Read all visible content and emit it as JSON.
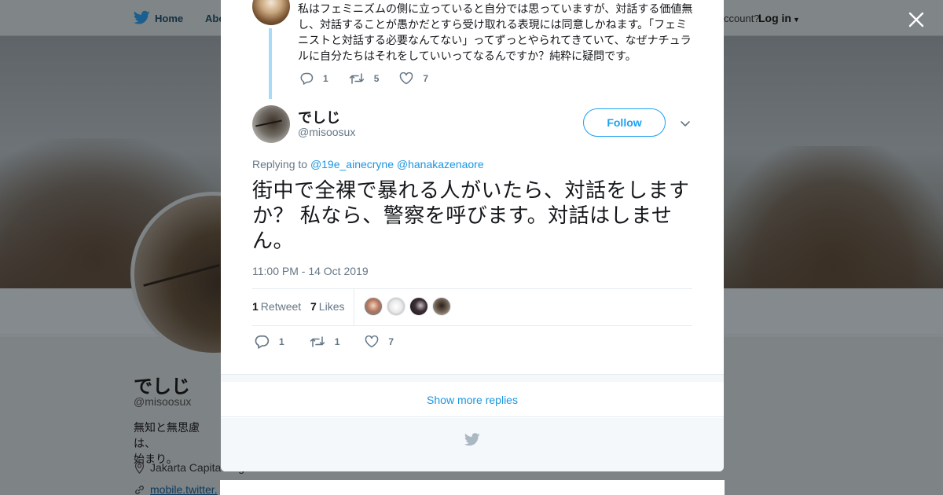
{
  "topbar": {
    "home_label": "Home",
    "about_label": "Abo",
    "account_text": "ccount?",
    "login_label": "Log in"
  },
  "profile": {
    "name": "でしじ",
    "handle": "@misoosux",
    "bio_line1": "無知と無思慮は、",
    "bio_line2": "始まり。",
    "location": "Jakarta Capita",
    "location_tail": "g",
    "url": "mobile.twitter."
  },
  "modal": {
    "previous_tweet": {
      "text": "私はフェミニズムの側に立っていると自分では思っていますが、対話する価値無し、対話することが愚かだとすら受け取れる表現には同意しかねます。「フェミニストと対話する必要なんてない」ってずっとやられてきていて、なぜナチュラルに自分たちはそれをしていいってなるんですか？純粋に疑問です。",
      "replies": "1",
      "retweets": "5",
      "likes": "7"
    },
    "author": {
      "name": "でしじ",
      "handle": "@misoosux",
      "follow_label": "Follow"
    },
    "replying_prefix": "Replying to",
    "replying_to": [
      "@19e_ainecryne",
      "@hanakazenaore"
    ],
    "tweet_text": "街中で全裸で暴れる人がいたら、対話をしますか？ 私なら、警察を呼びます。対話はしません。",
    "timestamp": "11:00 PM - 14 Oct 2019",
    "stats": {
      "retweet_count": "1",
      "retweet_label": "Retweet",
      "likes_count": "7",
      "likes_label": "Likes"
    },
    "actions": {
      "replies": "1",
      "retweets": "1",
      "likes": "7"
    },
    "show_more_label": "Show more replies"
  },
  "colors": {
    "accent": "#1da1f2",
    "link": "#1b95e0",
    "muted": "#657786",
    "thread_line": "#aadbf6"
  }
}
